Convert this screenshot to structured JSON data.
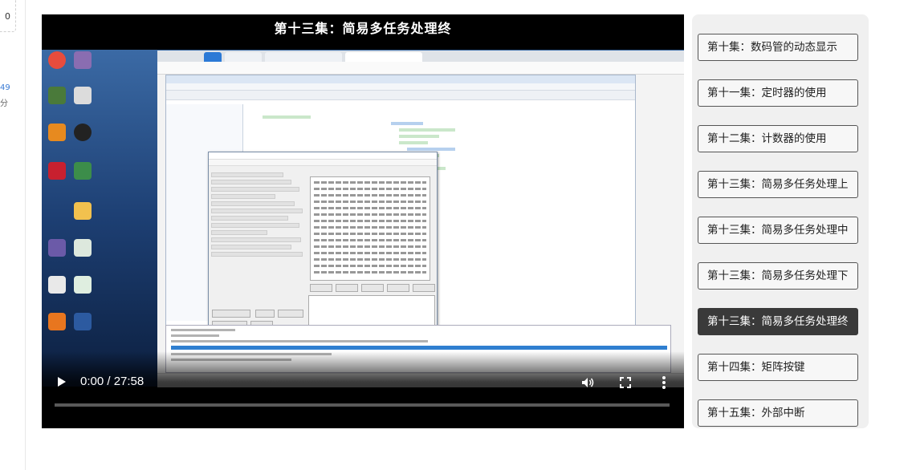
{
  "sidebar_fragment": {
    "top_text": "0",
    "count": "49",
    "unit": "分"
  },
  "player": {
    "title": "第十三集：简易多任务处理终",
    "current_time": "0:00",
    "duration": "27:58",
    "time_display": "0:00 / 27:58",
    "progress": 0.0,
    "icons": [
      "play-icon",
      "volume-icon",
      "fullscreen-icon",
      "more-vert-icon"
    ]
  },
  "playlist": {
    "episodes": [
      {
        "label": "第十集：数码管的动态显示",
        "active": false
      },
      {
        "label": "第十一集：定时器的使用",
        "active": false
      },
      {
        "label": "第十二集：计数器的使用",
        "active": false
      },
      {
        "label": "第十三集：简易多任务处理上",
        "active": false
      },
      {
        "label": "第十三集：简易多任务处理中",
        "active": false
      },
      {
        "label": "第十三集：简易多任务处理下",
        "active": false
      },
      {
        "label": "第十三集：简易多任务处理终",
        "active": true
      },
      {
        "label": "第十四集：矩阵按键",
        "active": false
      },
      {
        "label": "第十五集：外部中断",
        "active": false
      }
    ],
    "active_color": "#3a3a3a"
  }
}
